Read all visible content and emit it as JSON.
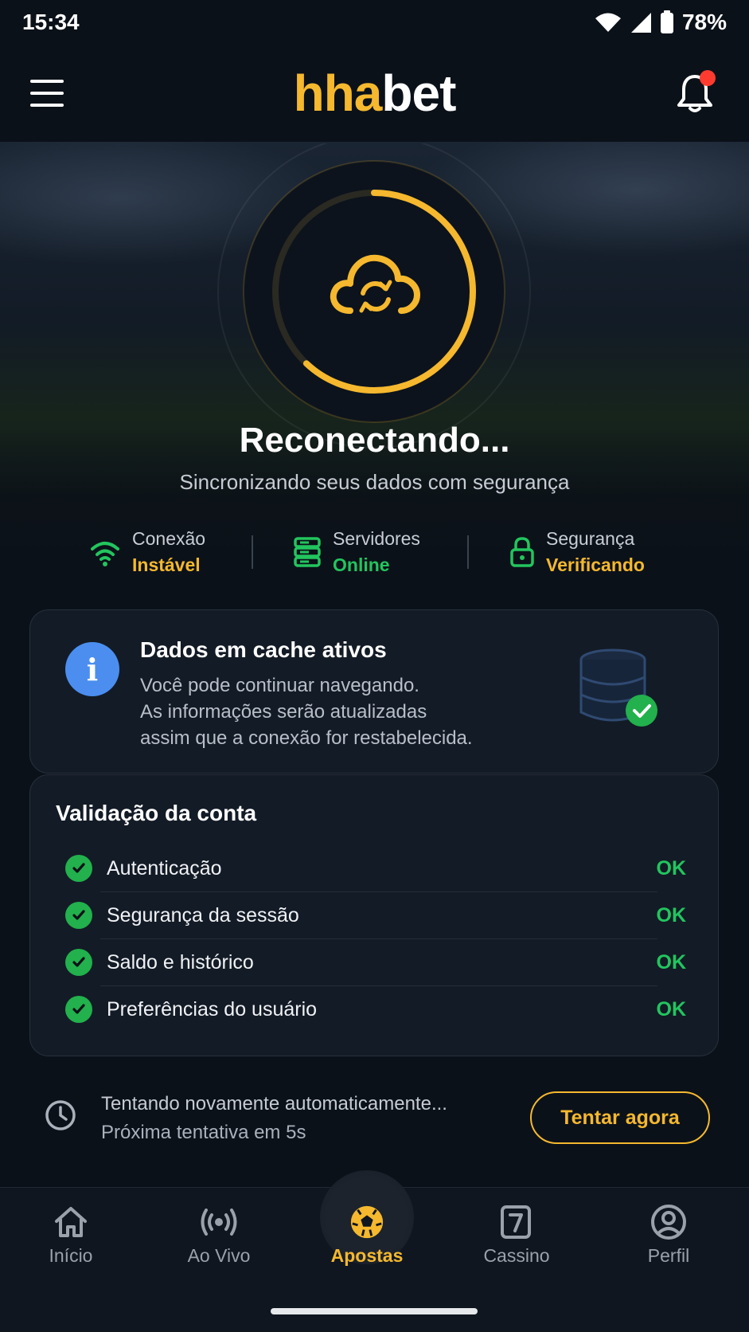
{
  "status_bar": {
    "time": "15:34",
    "battery": "78%"
  },
  "header": {
    "logo_part1": "hha",
    "logo_part2": "bet"
  },
  "hero": {
    "title": "Reconectando...",
    "subtitle": "Sincronizando seus dados com segurança",
    "progress": 0.62
  },
  "status": [
    {
      "label": "Conexão",
      "value": "Instável",
      "color": "#f5b82e",
      "icon": "wifi-icon"
    },
    {
      "label": "Servidores",
      "value": "Online",
      "color": "#22c55e",
      "icon": "server-icon"
    },
    {
      "label": "Segurança",
      "value": "Verificando",
      "color": "#f5b82e",
      "icon": "lock-icon"
    }
  ],
  "cache_card": {
    "title": "Dados em cache ativos",
    "line1": "Você pode continuar navegando.",
    "line2": "As informações serão atualizadas",
    "line3": "assim que a conexão for restabelecida."
  },
  "validation": {
    "title": "Validação da conta",
    "items": [
      {
        "label": "Autenticação",
        "status": "OK"
      },
      {
        "label": "Segurança da sessão",
        "status": "OK"
      },
      {
        "label": "Saldo e histórico",
        "status": "OK"
      },
      {
        "label": "Preferências do usuário",
        "status": "OK"
      }
    ]
  },
  "retry": {
    "line1": "Tentando novamente automaticamente...",
    "line2": "Próxima tentativa em 5s",
    "button": "Tentar agora"
  },
  "nav": [
    {
      "label": "Início",
      "icon": "home-icon"
    },
    {
      "label": "Ao Vivo",
      "icon": "live-icon"
    },
    {
      "label": "Apostas",
      "icon": "soccer-ball-icon",
      "active": true
    },
    {
      "label": "Cassino",
      "icon": "slot-seven-icon"
    },
    {
      "label": "Perfil",
      "icon": "profile-icon"
    }
  ],
  "colors": {
    "accent": "#f5b82e",
    "success": "#22c55e",
    "info": "#4b8ef0",
    "background": "#0b1119"
  }
}
